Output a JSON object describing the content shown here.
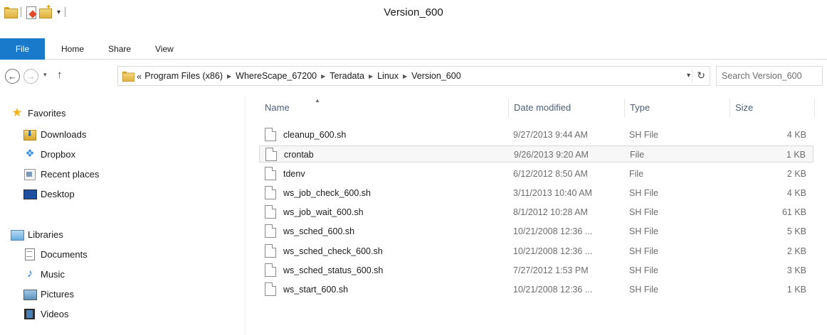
{
  "window": {
    "title": "Version_600",
    "qat_dropdown": "▾"
  },
  "ribbon": {
    "tabs": [
      {
        "label": "File"
      },
      {
        "label": "Home"
      },
      {
        "label": "Share"
      },
      {
        "label": "View"
      }
    ]
  },
  "nav": {
    "back": "←",
    "forward": "→",
    "recent": "▾",
    "up": "↑"
  },
  "address": {
    "overflow": "«",
    "crumbs": [
      "Program Files (x86)",
      "WhereScape_67200",
      "Teradata",
      "Linux",
      "Version_600"
    ],
    "separator": "▶",
    "dropdown": "▾",
    "refresh": "↻"
  },
  "search": {
    "placeholder": "Search Version_600"
  },
  "sidebar": {
    "favorites": [
      {
        "label": "Favorites",
        "icon": "star-icon"
      },
      {
        "label": "Downloads",
        "icon": "downloads-icon"
      },
      {
        "label": "Dropbox",
        "icon": "dropbox-icon"
      },
      {
        "label": "Recent places",
        "icon": "recent-places-icon"
      },
      {
        "label": "Desktop",
        "icon": "desktop-icon"
      }
    ],
    "libraries": [
      {
        "label": "Libraries",
        "icon": "libraries-icon"
      },
      {
        "label": "Documents",
        "icon": "documents-icon"
      },
      {
        "label": "Music",
        "icon": "music-icon"
      },
      {
        "label": "Pictures",
        "icon": "pictures-icon"
      },
      {
        "label": "Videos",
        "icon": "videos-icon"
      }
    ]
  },
  "file_list": {
    "columns": [
      "Name",
      "Date modified",
      "Type",
      "Size"
    ],
    "sort_indicator": "▲",
    "rows": [
      {
        "name": "cleanup_600.sh",
        "date": "9/27/2013 9:44 AM",
        "type": "SH File",
        "size": "4 KB"
      },
      {
        "name": "crontab",
        "date": "9/26/2013 9:20 AM",
        "type": "File",
        "size": "1 KB"
      },
      {
        "name": "tdenv",
        "date": "6/12/2012 8:50 AM",
        "type": "File",
        "size": "2 KB"
      },
      {
        "name": "ws_job_check_600.sh",
        "date": "3/11/2013 10:40 AM",
        "type": "SH File",
        "size": "4 KB"
      },
      {
        "name": "ws_job_wait_600.sh",
        "date": "8/1/2012 10:28 AM",
        "type": "SH File",
        "size": "61 KB"
      },
      {
        "name": "ws_sched_600.sh",
        "date": "10/21/2008 12:36 ...",
        "type": "SH File",
        "size": "5 KB"
      },
      {
        "name": "ws_sched_check_600.sh",
        "date": "10/21/2008 12:36 ...",
        "type": "SH File",
        "size": "2 KB"
      },
      {
        "name": "ws_sched_status_600.sh",
        "date": "7/27/2012 1:53 PM",
        "type": "SH File",
        "size": "3 KB"
      },
      {
        "name": "ws_start_600.sh",
        "date": "10/21/2008 12:36 ...",
        "type": "SH File",
        "size": "1 KB"
      }
    ]
  },
  "colors": {
    "file_tab": "#1979ca",
    "header_text": "#4c607a",
    "secondary_text": "#6d6d6d"
  }
}
